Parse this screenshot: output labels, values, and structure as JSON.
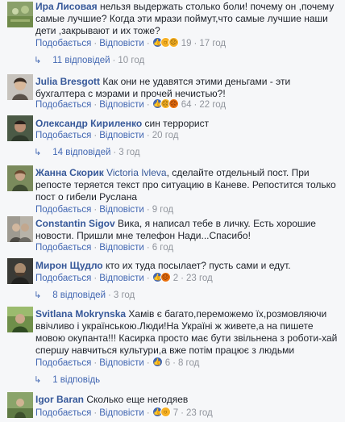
{
  "labels": {
    "like": "Подобається",
    "reply": "Відповісти",
    "separator": "·"
  },
  "comments": [
    {
      "author": "Ира Лисовая",
      "text": "нельзя выдержать столько боли! почему он ,почему самые лучшие? Когда эти мрази поймут,что самые лучшие наши дети ,закрывают и их тоже?",
      "reactions": [
        "like-icon",
        "wow-icon",
        "sad-icon"
      ],
      "reaction_count": "19",
      "time": "17 год",
      "replies": {
        "label": "11 відповідей",
        "time": "10 год"
      }
    },
    {
      "author": "Julia Bresgott",
      "text": "Как они не удавятся этими деньгами - эти бухгалтера с мэрами и прочей нечистью?!",
      "reactions": [
        "like-icon",
        "sad-icon",
        "angry-icon"
      ],
      "reaction_count": "64",
      "time": "22 год"
    },
    {
      "author": "Олександр Кириленко",
      "text": "син террорист",
      "reactions": [],
      "reaction_count": "",
      "time": "20 год",
      "replies": {
        "label": "14 відповідей",
        "time": "3 год"
      }
    },
    {
      "author": "Жанна Скорик",
      "mention": "Victoria Ivleva",
      "text": ", сделайте отдельный пост. При репосте теряется текст про ситуацию в Каневе. Репостится только пост о гибели Руслана",
      "reactions": [],
      "reaction_count": "",
      "time": "9 год"
    },
    {
      "author": "Constantin Sigov",
      "text": "Вика, я написал тебе в личку. Есть хорошие новости. Пришли мне телефон Нади...Спасибо!",
      "reactions": [],
      "reaction_count": "",
      "time": "6 год"
    },
    {
      "author": "Мирон Щудло",
      "text": "кто их туда посылает? пусть сами и едут.",
      "reactions": [
        "like-icon",
        "angry-icon"
      ],
      "reaction_count": "2",
      "time": "23 год",
      "replies": {
        "label": "8 відповідей",
        "time": "3 год"
      }
    },
    {
      "author": "Svitlana Mokrynska",
      "text": "Хамів є багато,переможемо їх,розмовляючи ввічливо і українською.Люди!На Україні ж живете,а на пишете мовою окупанта!!! Касирка просто має бути звільнена з роботи-хай спершу навчиться культури,а вже потім працює з людьми",
      "reactions": [
        "like-icon"
      ],
      "reaction_count": "6",
      "time": "8 год",
      "replies": {
        "label": "1 відповідь",
        "time": ""
      }
    },
    {
      "author": "Igor Baran",
      "text": "Сколько еще негодяев",
      "reactions": [
        "like-icon",
        "wow-icon"
      ],
      "reaction_count": "7",
      "time": "23 год"
    }
  ]
}
